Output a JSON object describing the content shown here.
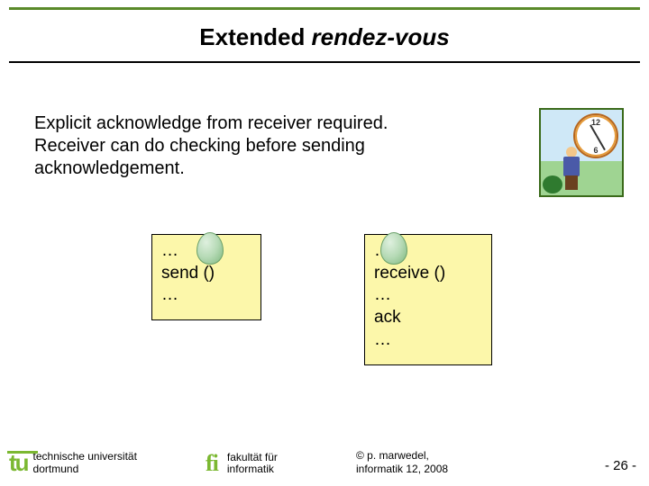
{
  "title": {
    "plain": "Extended ",
    "italic": "rendez-vous"
  },
  "body": {
    "line1": "Explicit acknowledge from receiver required.",
    "line2": "Receiver can do checking before sending acknowledgement."
  },
  "box1": {
    "l1": "…",
    "l2": "send ()",
    "l3": "…"
  },
  "box2": {
    "l1": "…",
    "l2": "receive ()",
    "l3": "…",
    "l4": "ack",
    "l5": "…"
  },
  "clipart": {
    "n12": "12",
    "n6": "6"
  },
  "footer": {
    "tu_mark": "tu",
    "uni_line1": "technische universität",
    "uni_line2": "dortmund",
    "fi_mark": "fi",
    "fi_line1": "fakultät für",
    "fi_line2": "informatik",
    "copy_line1": "©  p. marwedel,",
    "copy_line2": "informatik 12,  2008",
    "page": "-  26 -"
  }
}
